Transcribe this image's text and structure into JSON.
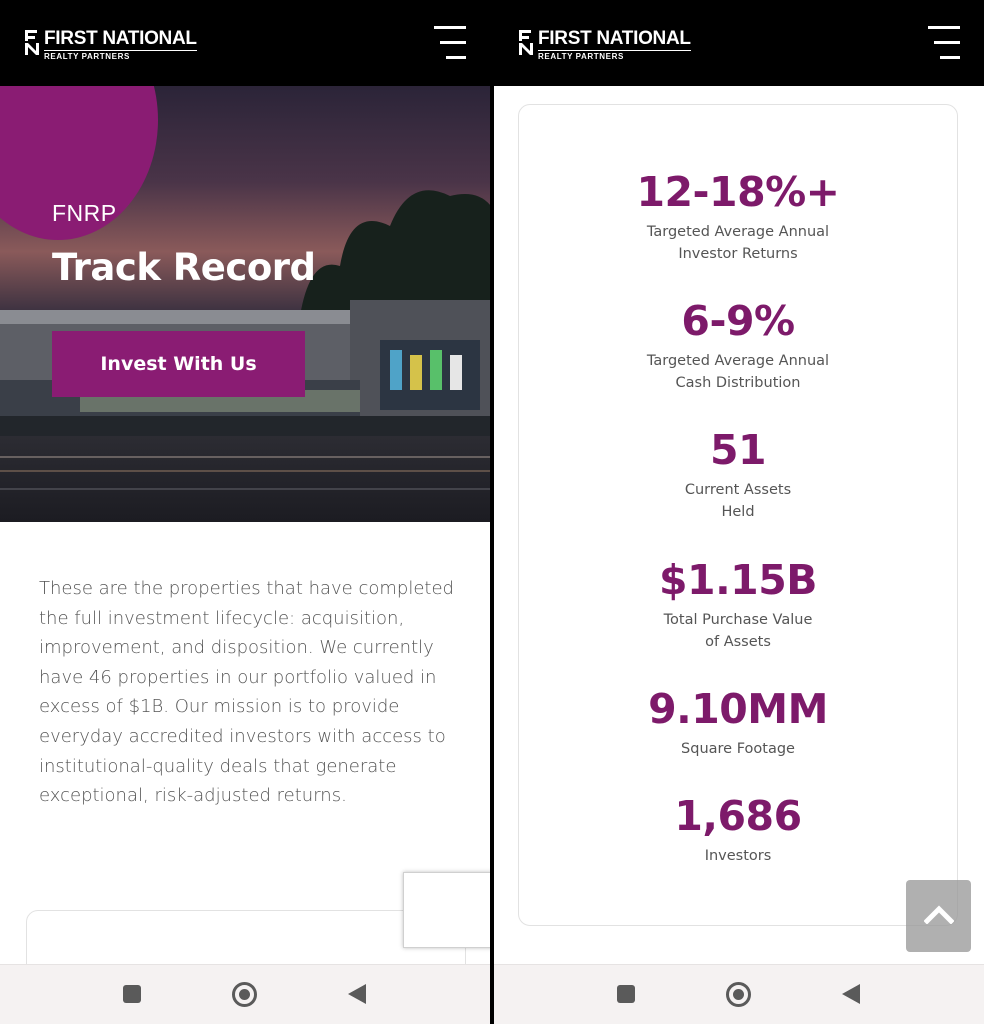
{
  "brand": {
    "name": "FIRST NATIONAL",
    "tagline": "REALTY PARTNERS"
  },
  "hero": {
    "eyebrow": "FNRP",
    "title": "Track Record",
    "cta_label": "Invest With Us"
  },
  "intro": {
    "text": "These are the properties that have completed the full investment lifecycle: acquisition, improvement, and disposition. We currently have 46 properties in our portfolio valued in excess of $1B. Our mission is to provide everyday accredited investors with access to institutional-quality deals that generate exceptional, risk-adjusted returns."
  },
  "stats": [
    {
      "value": "12-18%+",
      "label_line1": "Targeted Average Annual",
      "label_line2": "Investor Returns"
    },
    {
      "value": "6-9%",
      "label_line1": "Targeted Average Annual",
      "label_line2": "Cash Distribution"
    },
    {
      "value": "51",
      "label_line1": "Current Assets",
      "label_line2": "Held"
    },
    {
      "value": "$1.15B",
      "label_line1": "Total Purchase Value",
      "label_line2": "of Assets"
    },
    {
      "value": "9.10MM",
      "label_line1": "Square Footage",
      "label_line2": ""
    },
    {
      "value": "1,686",
      "label_line1": "Investors",
      "label_line2": ""
    }
  ],
  "colors": {
    "accent": "#8a1c73",
    "stat_text": "#7d1a6a",
    "topbar": "#000000"
  },
  "icons": {
    "menu": "hamburger-icon",
    "back_to_top": "chevron-up-icon",
    "nav_recents": "square-icon",
    "nav_home": "circle-icon",
    "nav_back": "triangle-back-icon"
  }
}
